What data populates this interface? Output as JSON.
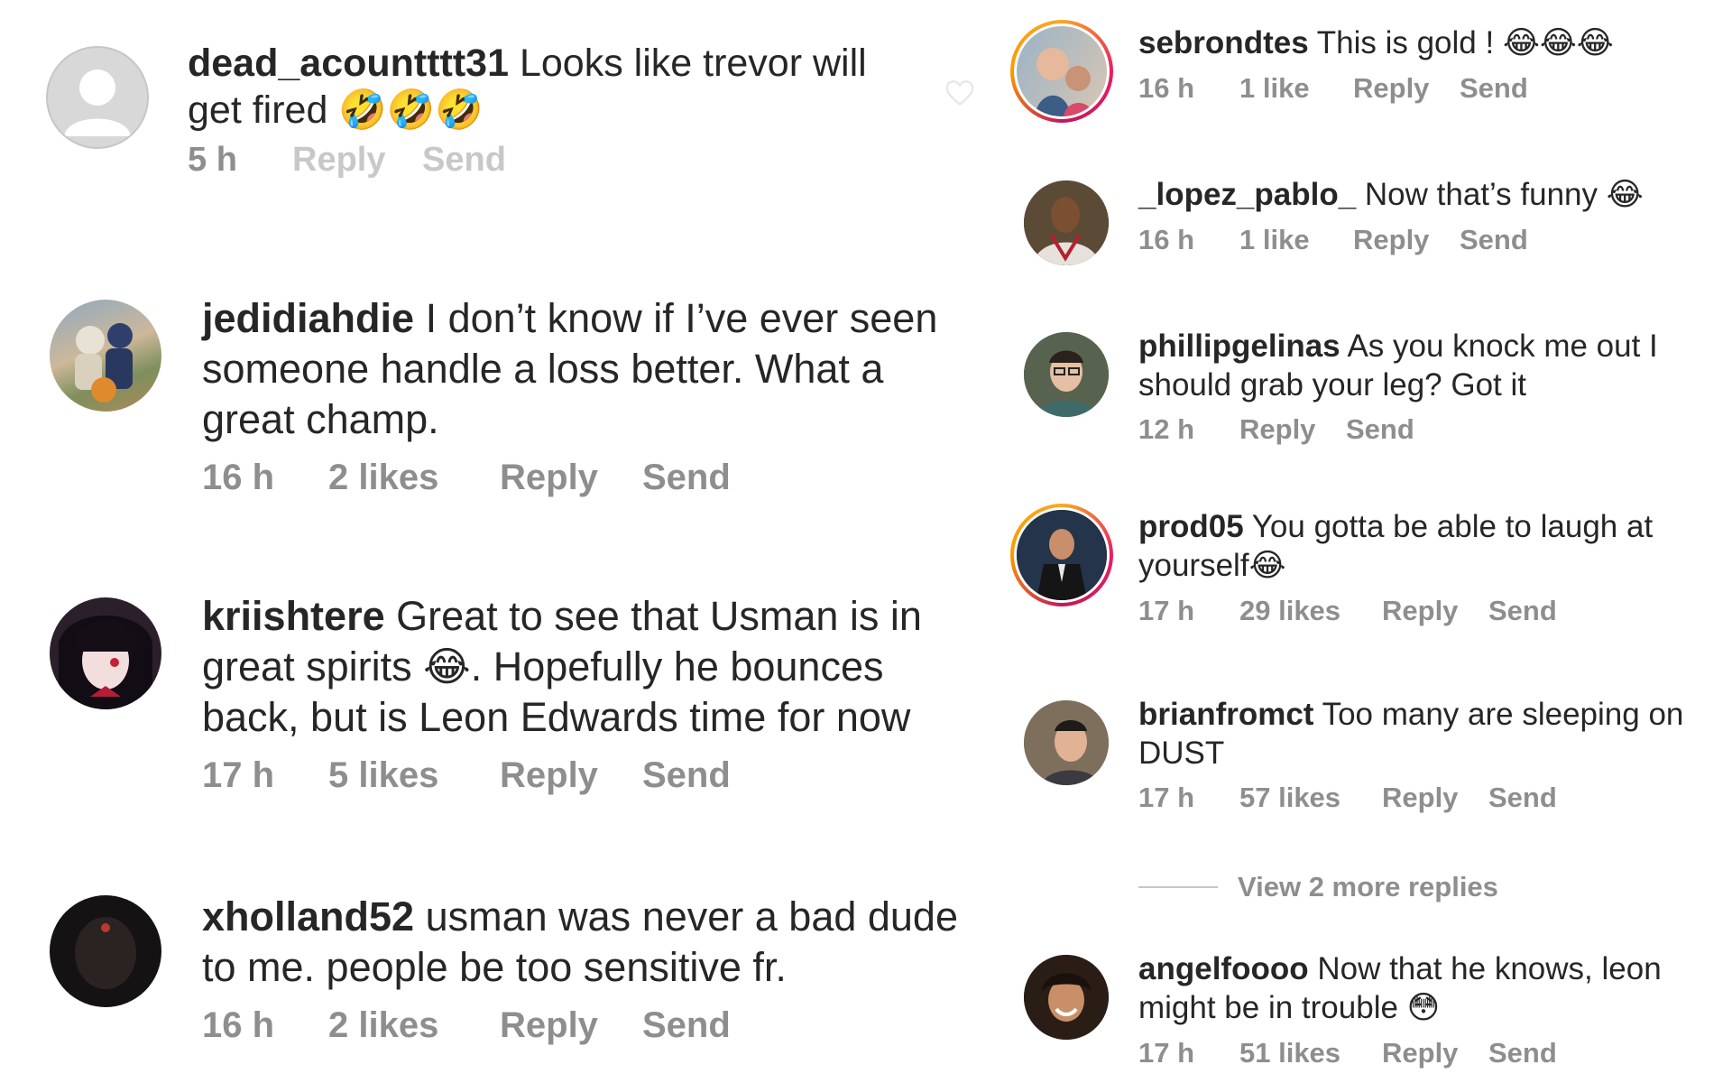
{
  "left_comments": [
    {
      "username": "dead_acountttt31",
      "text": "Looks like trevor will get fired ",
      "emoji": "🤣🤣🤣",
      "time": "5 h",
      "likes": "",
      "reply": "Reply",
      "send": "Send"
    },
    {
      "username": "jedidiahdie",
      "text": "I don’t know if I’ve ever seen someone handle a loss better. What a great champ.",
      "time": "16 h",
      "likes": "2 likes",
      "reply": "Reply",
      "send": "Send"
    },
    {
      "username": "kriishtere",
      "text_before": "Great to see that Usman is in great spirits ",
      "emoji": "😂",
      "text_after": ". Hopefully he bounces back, but is Leon Edwards time for now",
      "time": "17 h",
      "likes": "5 likes",
      "reply": "Reply",
      "send": "Send"
    },
    {
      "username": "xholland52",
      "text": "usman was never a bad dude to me. people be too sensitive fr.",
      "time": "16 h",
      "likes": "2 likes",
      "reply": "Reply",
      "send": "Send"
    }
  ],
  "right_comments": [
    {
      "username": "sebrondtes",
      "text": "This is gold ! ",
      "emoji": "😂😂😂",
      "time": "16 h",
      "likes": "1 like",
      "reply": "Reply",
      "send": "Send"
    },
    {
      "username": "_lopez_pablo_",
      "text": "Now that’s funny ",
      "emoji": "😂",
      "time": "16 h",
      "likes": "1 like",
      "reply": "Reply",
      "send": "Send"
    },
    {
      "username": "phillipgelinas",
      "text": "As you knock me out I should grab your leg?  Got it",
      "time": "12 h",
      "likes": "",
      "reply": "Reply",
      "send": "Send"
    },
    {
      "username": "prod05",
      "text": "You gotta be able to laugh at yourself",
      "emoji": "😂",
      "time": "17 h",
      "likes": "29 likes",
      "reply": "Reply",
      "send": "Send"
    },
    {
      "username": "brianfromct",
      "text": "Too many are sleeping on DUST",
      "time": "17 h",
      "likes": "57 likes",
      "reply": "Reply",
      "send": "Send"
    },
    {
      "username": "angelfoooo",
      "text": "Now that he knows, leon might be in trouble ",
      "emoji": "😳",
      "time": "17 h",
      "likes": "51 likes",
      "reply": "Reply",
      "send": "Send"
    }
  ],
  "view_more": "View 2 more replies",
  "colors": {
    "text": "#262626",
    "meta": "#8e8e8e",
    "ring": "#e91e63"
  }
}
